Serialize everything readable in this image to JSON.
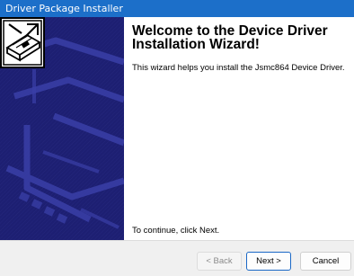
{
  "window": {
    "title": "Driver Package Installer"
  },
  "main": {
    "heading_line1": "Welcome to the Device Driver",
    "heading_line2": "Installation Wizard!",
    "intro": "This wizard helps you install the Jsmc864 Device Driver.",
    "continue_hint": "To continue, click Next."
  },
  "footer": {
    "back_label": "< Back",
    "next_label": "Next >",
    "cancel_label": "Cancel"
  },
  "icons": {
    "device": "device-driver-icon"
  },
  "colors": {
    "titlebar": "#1c6fc9",
    "banner": "#1d1f72",
    "default_button_border": "#1a68c6"
  },
  "state": {
    "back_enabled": false,
    "default_button": "next"
  }
}
